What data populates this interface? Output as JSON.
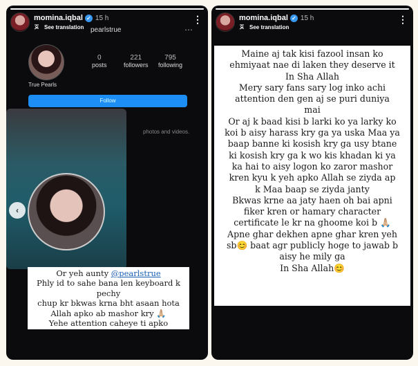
{
  "story_left": {
    "username": "momina.iqbal",
    "time": "15 h",
    "translate_label": "See translation",
    "profile": {
      "handle": "pearlstrue",
      "stats": [
        {
          "value": "0",
          "label": "posts"
        },
        {
          "value": "221",
          "label": "followers"
        },
        {
          "value": "795",
          "label": "following"
        }
      ],
      "name": "True Pearls",
      "follow_label": "Follow",
      "tail_text": "photos and videos."
    },
    "caption": {
      "line1_prefix": "Or yeh aunty ",
      "mention": "@pearlstrue",
      "lines": [
        "Phly id to sahe bana len keyboard k pechy",
        "chup kr bkwas krna bht asaan hota",
        "Allah apko ab mashor kry 🙏🏼",
        "Yehe attention caheye ti apko"
      ]
    }
  },
  "story_right": {
    "username": "momina.iqbal",
    "time": "15 h",
    "translate_label": "See translation",
    "lines": [
      "Maine aj tak kisi fazool insan ko",
      "ehmiyaat nae di laken they deserve it",
      "In Sha Allah",
      "Mery sary fans sary log inko achi",
      "attention den gen aj se puri duniya",
      "mai",
      "Or aj k baad kisi b larki ko ya larky ko",
      "koi b aisy harass kry ga ya uska Maa ya",
      "baap banne ki kosish kry ga usy btane",
      "ki kosish kry ga k wo kis khadan ki ya",
      "ka hai to aisy logon ko zaror mashor",
      "kren kyu k yeh apko Allah se ziyda ap",
      "k Maa baap se ziyda janty",
      "Bkwas krne aa jaty haen oh bai apni",
      "fiker kren or hamary  character",
      "certificate le kr na ghoome koi b 🙏🏼",
      "Apne ghar dekhen apne ghar kren yeh",
      "sb😊 baat agr publicly hoge to jawab b",
      "aisy he mily ga",
      "In Sha Allah😊"
    ]
  },
  "colors": {
    "story_bg": "#0b0b0d",
    "follow_button": "#1d8ef5",
    "verified": "#3897f0",
    "mention": "#1a5fb4"
  }
}
